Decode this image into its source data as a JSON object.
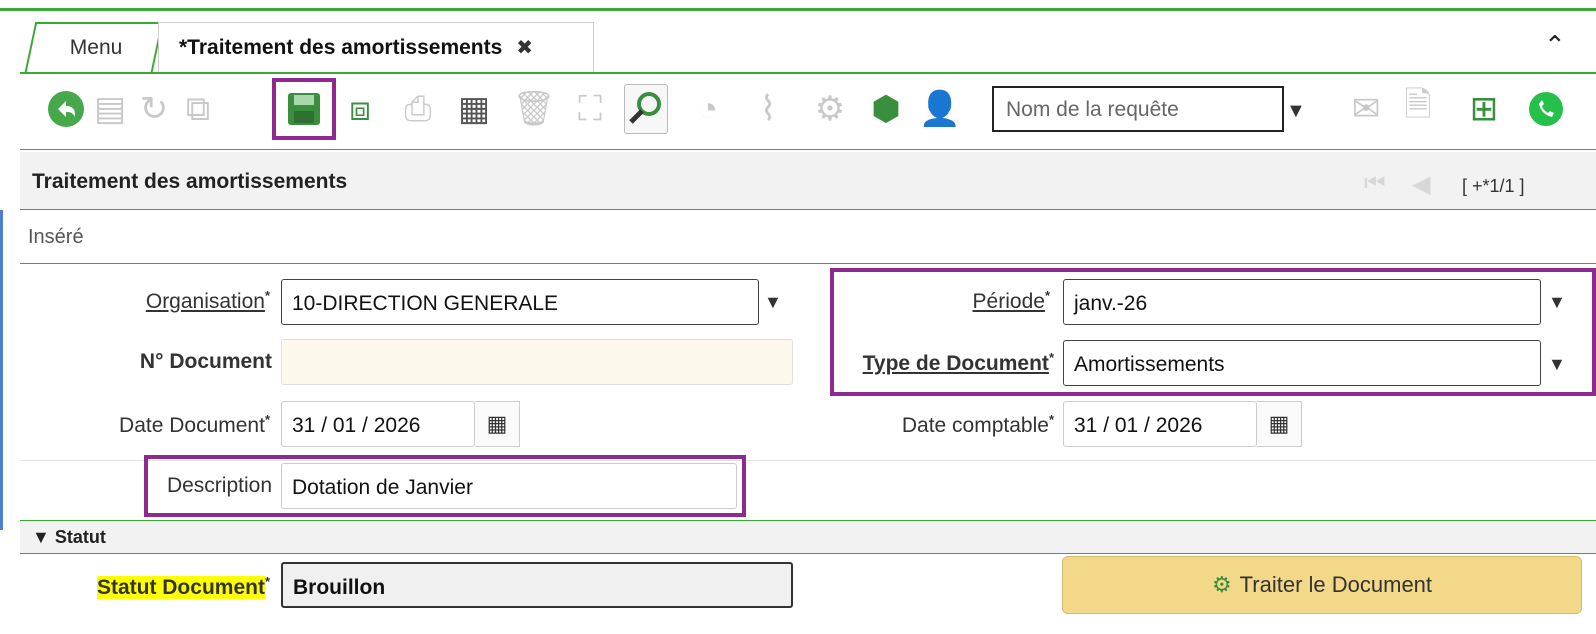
{
  "tabs": {
    "menu_label": "Menu",
    "active_label": "*Traitement des amortissements",
    "close_glyph": "✖",
    "collapse_glyph": "⌃"
  },
  "toolbar": {
    "query_placeholder": "Nom de la requête",
    "icons": [
      "back-icon",
      "new-record-icon",
      "refresh-icon",
      "copy-icon",
      "save-icon",
      "save-new-icon",
      "print-icon",
      "grid-icon",
      "delete-icon",
      "zoom-icon",
      "search-icon",
      "chart-icon",
      "attachment-icon",
      "process-icon",
      "package-icon",
      "user-icon",
      "mail-icon",
      "document-icon",
      "workflow-icon",
      "whatsapp-icon"
    ]
  },
  "section": {
    "title": "Traitement des amortissements",
    "counter": "[ +*1/1 ]",
    "status_text": "Inséré"
  },
  "form": {
    "organisation_label": "Organisation",
    "organisation_value": "10-DIRECTION GENERALE",
    "periode_label": "Période",
    "periode_value": "janv.-26",
    "ndocument_label": "N° Document",
    "ndocument_value": "",
    "type_document_label": "Type de Document",
    "type_document_value": "Amortissements",
    "date_document_label": "Date Document",
    "date_document_value": "31 / 01 / 2026",
    "date_comptable_label": "Date comptable",
    "date_comptable_value": "31 / 01 / 2026",
    "description_label": "Description",
    "description_value": "Dotation de Janvier",
    "required_mark": "*"
  },
  "statut": {
    "section_label": "Statut",
    "statut_document_label": "Statut Document",
    "statut_document_value": "Brouillon",
    "process_button_label": "Traiter le Document"
  },
  "colors": {
    "accent_green": "#3aa935",
    "highlight_purple": "#8e2a8f",
    "button_gold": "#f3d88a"
  }
}
